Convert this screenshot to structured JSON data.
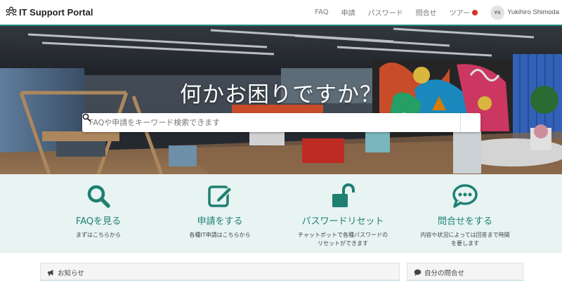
{
  "header": {
    "brand_title": "IT Support Portal",
    "brand_icon": "people-group-icon",
    "nav": [
      "FAQ",
      "申請",
      "パスワード",
      "問合せ"
    ],
    "tour_label": "ツアー",
    "user_initials": "YS",
    "user_name": "Yukihiro Shimoda",
    "accent_color": "#1f8a78",
    "tour_dot_color": "#d9312b"
  },
  "hero": {
    "title": "何かお困りですか？",
    "search_placeholder": "FAQや申請をキーワード検索できます",
    "search_icon": "search-icon"
  },
  "features": [
    {
      "icon": "search-icon",
      "title": "FAQを見る",
      "desc1": "まずはこちらから",
      "desc2": ""
    },
    {
      "icon": "edit-icon",
      "title": "申請をする",
      "desc1": "各種IT申請はこちらから",
      "desc2": ""
    },
    {
      "icon": "unlock-icon",
      "title": "パスワードリセット",
      "desc1": "チャットボットで各種パスワードの",
      "desc2": "リセットができます"
    },
    {
      "icon": "chat-bubble-icon",
      "title": "問合せをする",
      "desc1": "内容や状況によっては回答まで時間",
      "desc2": "を要します"
    }
  ],
  "panels": {
    "news_title": "お知らせ",
    "news_icon": "megaphone-icon",
    "inquiries_title": "自分の問合せ",
    "inquiries_icon": "comment-icon"
  },
  "colors": {
    "feature_bg": "#e7f4f2",
    "feature_teal": "#1f7f71"
  }
}
